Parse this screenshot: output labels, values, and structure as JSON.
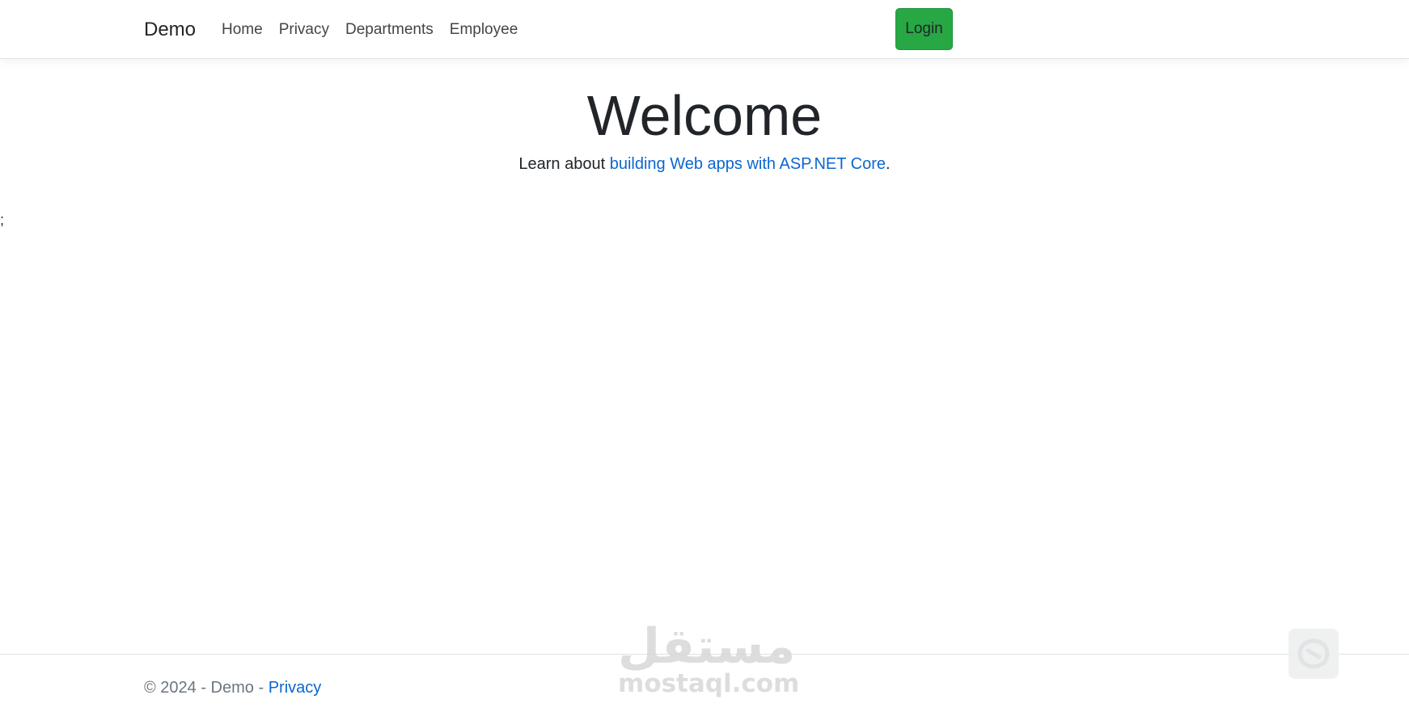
{
  "navbar": {
    "brand": "Demo",
    "links": [
      "Home",
      "Privacy",
      "Departments",
      "Employee"
    ],
    "login_label": "Login",
    "login_color": "#28a745"
  },
  "main": {
    "title": "Welcome",
    "learn_prefix": "Learn about ",
    "learn_link": "building Web apps with ASP.NET Core",
    "learn_suffix": ".",
    "stray_text": ";"
  },
  "footer": {
    "copyright": "© 2024 - Demo - ",
    "privacy_link": "Privacy"
  },
  "watermark": {
    "arabic": "مستقل",
    "latin": "mostaql.com"
  },
  "colors": {
    "link": "#0b66d0",
    "muted": "#6c757d",
    "text": "#212529"
  }
}
